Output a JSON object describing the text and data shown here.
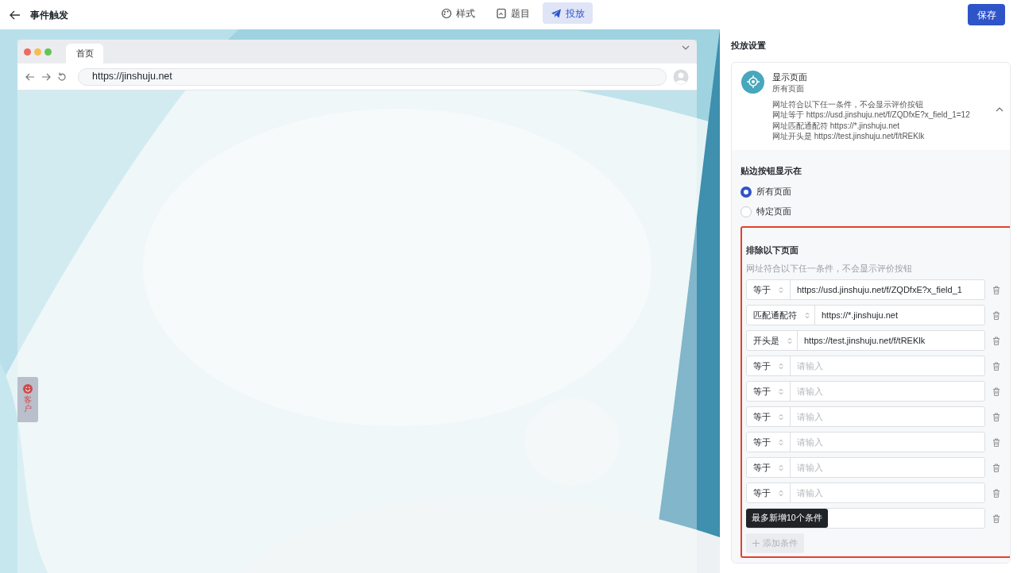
{
  "header": {
    "title": "事件触发",
    "save_button": "保存"
  },
  "tabs": [
    {
      "label": "样式",
      "selected": false
    },
    {
      "label": "题目",
      "selected": false
    },
    {
      "label": "投放",
      "selected": true
    }
  ],
  "browser": {
    "tab": "首页",
    "url": "https://jinshuju.net",
    "feedback_tab": "客户"
  },
  "settings": {
    "title": "投放设置",
    "display": {
      "title": "显示页面",
      "subtitle": "所有页面",
      "expanded": true,
      "lines": [
        "网址符合以下任一条件，不会显示评价按钮",
        "网址等于 https://usd.jinshuju.net/f/ZQDfxE?x_field_1=12",
        "网址匹配通配符 https://*.jinshuju.net",
        "网址开头是 https://test.jinshuju.net/f/tREKlk"
      ]
    },
    "edge_button": {
      "label": "贴边按钮显示在",
      "options": [
        {
          "label": "所有页面",
          "selected": true
        },
        {
          "label": "特定页面",
          "selected": false
        }
      ]
    },
    "exclude": {
      "title": "排除以下页面",
      "hint": "网址符合以下任一条件，不会显示评价按钮",
      "rows": [
        {
          "operator": "等于",
          "value": "https://usd.jinshuju.net/f/ZQDfxE?x_field_1"
        },
        {
          "operator": "匹配通配符",
          "value": "https://*.jinshuju.net"
        },
        {
          "operator": "开头是",
          "value": "https://test.jinshuju.net/f/tREKlk"
        },
        {
          "operator": "等于",
          "placeholder": "请输入"
        },
        {
          "operator": "等于",
          "placeholder": "请输入"
        },
        {
          "operator": "等于",
          "placeholder": "请输入"
        },
        {
          "operator": "等于",
          "placeholder": "请输入"
        },
        {
          "operator": "等于",
          "placeholder": "请输入"
        },
        {
          "operator": "等于",
          "placeholder": "请输入"
        },
        {
          "tooltip": "最多新增10个条件"
        }
      ],
      "add_button": {
        "label": "添加条件",
        "disabled": true
      }
    }
  }
}
